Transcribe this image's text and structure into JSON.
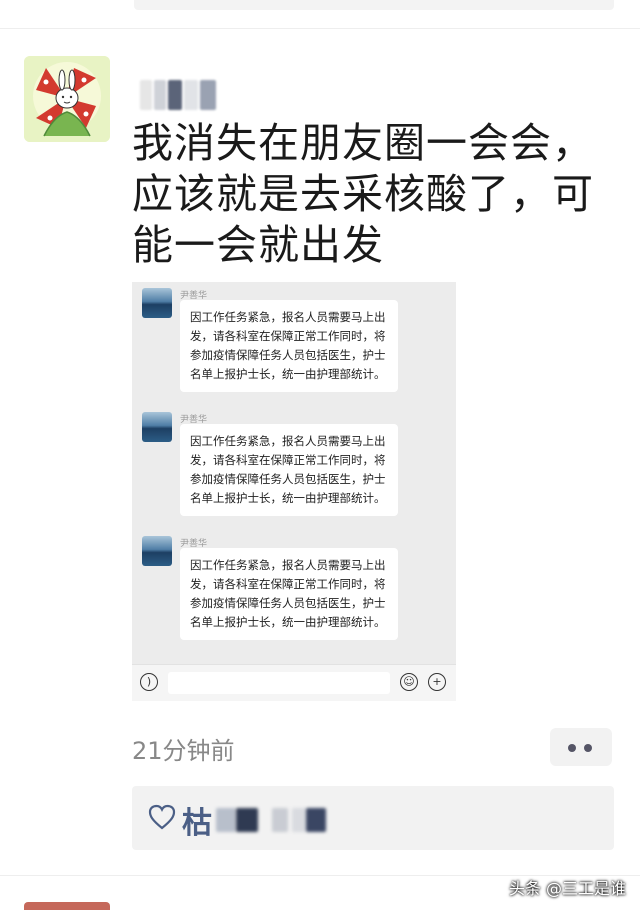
{
  "post": {
    "text": "我消失在朋友圈一会会，应该就是去采核酸了，可能一会就出发",
    "time": "21分钟前",
    "likes": {
      "first_char": "枯"
    }
  },
  "screenshot": {
    "messages": [
      {
        "sender": "尹善华",
        "text": "因工作任务紧急，报名人员需要马上出发，请各科室在保障正常工作同时，将参加疫情保障任务人员包括医生，护士名单上报护士长，统一由护理部统计。"
      },
      {
        "sender": "尹善华",
        "text": "因工作任务紧急，报名人员需要马上出发，请各科室在保障正常工作同时，将参加疫情保障任务人员包括医生，护士名单上报护士长，统一由护理部统计。"
      },
      {
        "sender": "尹善华",
        "text": "因工作任务紧急，报名人员需要马上出发，请各科室在保障正常工作同时，将参加疫情保障任务人员包括医生，护士名单上报护士长，统一由护理部统计。"
      }
    ],
    "icons": {
      "voice": "voice-icon",
      "emoji": "emoji-icon",
      "plus": "plus-icon"
    }
  },
  "watermark": "头条 @三工是谁",
  "colors": {
    "like_name": "#4b5f86",
    "time": "#888888",
    "panel": "#f2f2f2"
  }
}
